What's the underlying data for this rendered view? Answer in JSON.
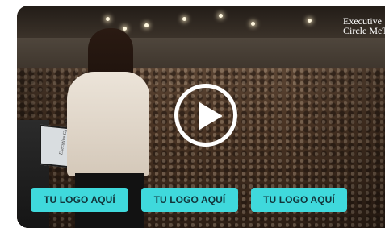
{
  "video": {
    "watermark_line1": "Executive",
    "watermark_line2": "Circle MeT",
    "podium_text": "Executive Circle Me",
    "play_label": "Play video"
  },
  "logo_buttons": [
    {
      "label": "TU LOGO AQUÍ"
    },
    {
      "label": "TU LOGO AQUÍ"
    },
    {
      "label": "TU LOGO AQUÍ"
    }
  ],
  "colors": {
    "button_bg": "#3fd9dc",
    "button_text": "#12343a",
    "play_ring": "#ffffff"
  },
  "icons": [
    "play-icon"
  ]
}
